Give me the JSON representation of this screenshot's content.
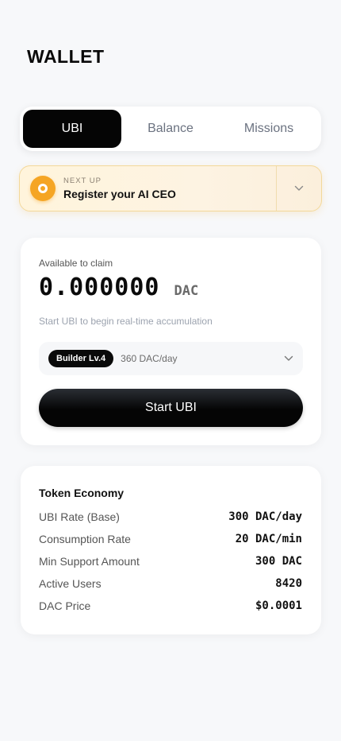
{
  "header": {
    "title": "WALLET"
  },
  "tabs": [
    {
      "label": "UBI",
      "active": true
    },
    {
      "label": "Balance",
      "active": false
    },
    {
      "label": "Missions",
      "active": false
    }
  ],
  "next_up": {
    "label": "NEXT UP",
    "title": "Register your AI CEO",
    "icon": "target-icon",
    "toggle_icon": "chevron-down-icon"
  },
  "claim": {
    "label": "Available to claim",
    "amount": "0.000000",
    "unit": "DAC",
    "hint": "Start UBI to begin real-time accumulation",
    "tier_badge": "Builder Lv.4",
    "tier_rate": "360 DAC/day",
    "start_label": "Start UBI"
  },
  "economy": {
    "title": "Token Economy",
    "rows": [
      {
        "key": "UBI Rate (Base)",
        "value": "300 DAC/day"
      },
      {
        "key": "Consumption Rate",
        "value": "20 DAC/min"
      },
      {
        "key": "Min Support Amount",
        "value": "300 DAC"
      },
      {
        "key": "Active Users",
        "value": "8420"
      },
      {
        "key": "DAC Price",
        "value": "$0.0001"
      }
    ]
  },
  "colors": {
    "accent": "#f5a524",
    "primary": "#050505",
    "background": "#f7f8fa"
  }
}
